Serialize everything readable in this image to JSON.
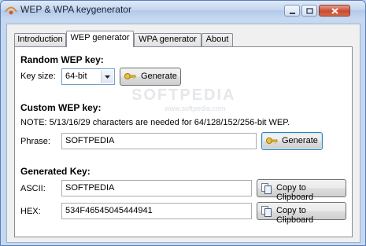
{
  "window": {
    "title": "WEP & WPA keygenerator"
  },
  "tabs": [
    {
      "label": "Introduction"
    },
    {
      "label": "WEP generator"
    },
    {
      "label": "WPA generator"
    },
    {
      "label": "About"
    }
  ],
  "active_tab": "WEP generator",
  "watermark": {
    "main": "SOFTPEDIA",
    "sub": "www.softpedia.com"
  },
  "random": {
    "heading": "Random WEP key:",
    "key_size_label": "Key size:",
    "key_size_value": "64-bit",
    "generate_label": "Generate"
  },
  "custom": {
    "heading": "Custom WEP key:",
    "note": "NOTE: 5/13/16/29 characters are needed for 64/128/152/256-bit WEP.",
    "phrase_label": "Phrase:",
    "phrase_value": "SOFTPEDIA",
    "generate_label": "Generate"
  },
  "generated": {
    "heading": "Generated Key:",
    "ascii_label": "ASCII:",
    "ascii_value": "SOFTPEDIA",
    "hex_label": "HEX:",
    "hex_value": "534F46545045444941",
    "copy_label": "Copy to Clipboard"
  },
  "icons": {
    "app": "app-icon",
    "generate": "key-icon",
    "copy": "copy-icon"
  }
}
